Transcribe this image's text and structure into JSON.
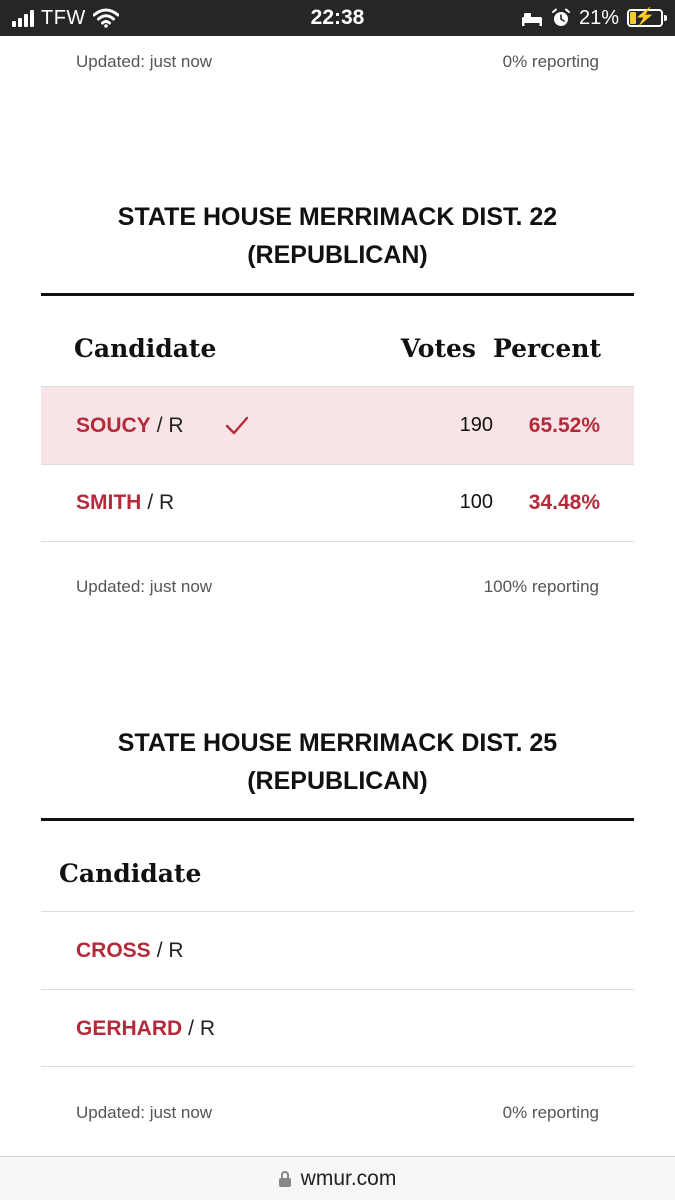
{
  "status_bar": {
    "carrier": "TFW",
    "time": "22:38",
    "battery_percent": "21%",
    "battery_level": 0.21,
    "icons": [
      "signal-icon",
      "wifi-icon",
      "sleep-icon",
      "alarm-icon",
      "battery-charging-icon"
    ]
  },
  "top_meta": {
    "updated": "Updated: just now",
    "reporting": "0% reporting"
  },
  "races": [
    {
      "title_line1": "STATE HOUSE MERRIMACK DIST. 22",
      "title_line2": "(REPUBLICAN)",
      "headers": {
        "candidate": "Candidate",
        "votes": "Votes",
        "percent": "Percent"
      },
      "rows": [
        {
          "name": "SOUCY",
          "party": "/ R",
          "votes": "190",
          "percent": "65.52%",
          "winner": true
        },
        {
          "name": "SMITH",
          "party": "/ R",
          "votes": "100",
          "percent": "34.48%",
          "winner": false
        }
      ],
      "updated": "Updated: just now",
      "reporting": "100% reporting"
    },
    {
      "title_line1": "STATE HOUSE MERRIMACK DIST. 25",
      "title_line2": "(REPUBLICAN)",
      "headers": {
        "candidate": "Candidate"
      },
      "rows": [
        {
          "name": "CROSS",
          "party": "/ R"
        },
        {
          "name": "GERHARD",
          "party": "/ R"
        }
      ],
      "updated": "Updated: just now",
      "reporting": "0% reporting"
    }
  ],
  "url_bar": {
    "domain": "wmur.com"
  },
  "colors": {
    "accent": "#b52a3a",
    "winner_row_bg": "#f8e4e6",
    "status_bar_bg": "#262626",
    "battery_fill": "#f5cc2e"
  }
}
